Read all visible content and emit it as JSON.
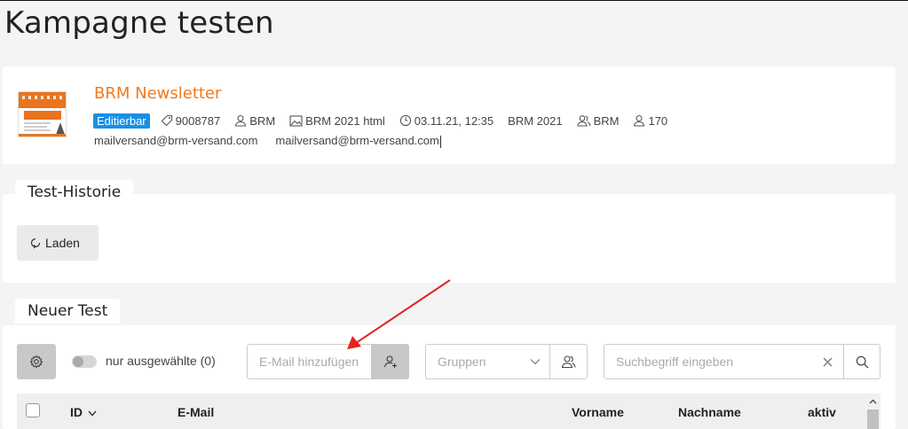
{
  "page": {
    "title": "Kampagne testen"
  },
  "campaign": {
    "name": "BRM Newsletter",
    "status_badge": "Editierbar",
    "meta": {
      "id": "9008787",
      "owner": "BRM",
      "template": "BRM 2021 html",
      "datetime": "03.11.21, 12:35",
      "category": "BRM 2021",
      "group": "BRM",
      "recipients": "170"
    },
    "sender_email": "mailversand@brm-versand.com",
    "reply_email": "mailversand@brm-versand.com"
  },
  "history": {
    "tab_label": "Test-Historie",
    "load_label": "Laden"
  },
  "new_test": {
    "tab_label": "Neuer Test",
    "toggle_label": "nur ausgewählte (0)",
    "email_placeholder": "E-Mail hinzufügen",
    "groups_placeholder": "Gruppen",
    "search_placeholder": "Suchbegriff eingeben",
    "table": {
      "columns": [
        "ID",
        "E-Mail",
        "Vorname",
        "Nachname",
        "aktiv"
      ]
    }
  },
  "colors": {
    "accent": "#f07a1d",
    "badge": "#1a8fe3",
    "annotation_arrow": "#e8221b"
  },
  "icons": [
    "tag-icon",
    "user-icon",
    "image-icon",
    "clock-icon",
    "users-icon",
    "gear-icon",
    "refresh-icon",
    "add-user-icon",
    "chevron-down-icon",
    "search-icon",
    "close-icon"
  ]
}
